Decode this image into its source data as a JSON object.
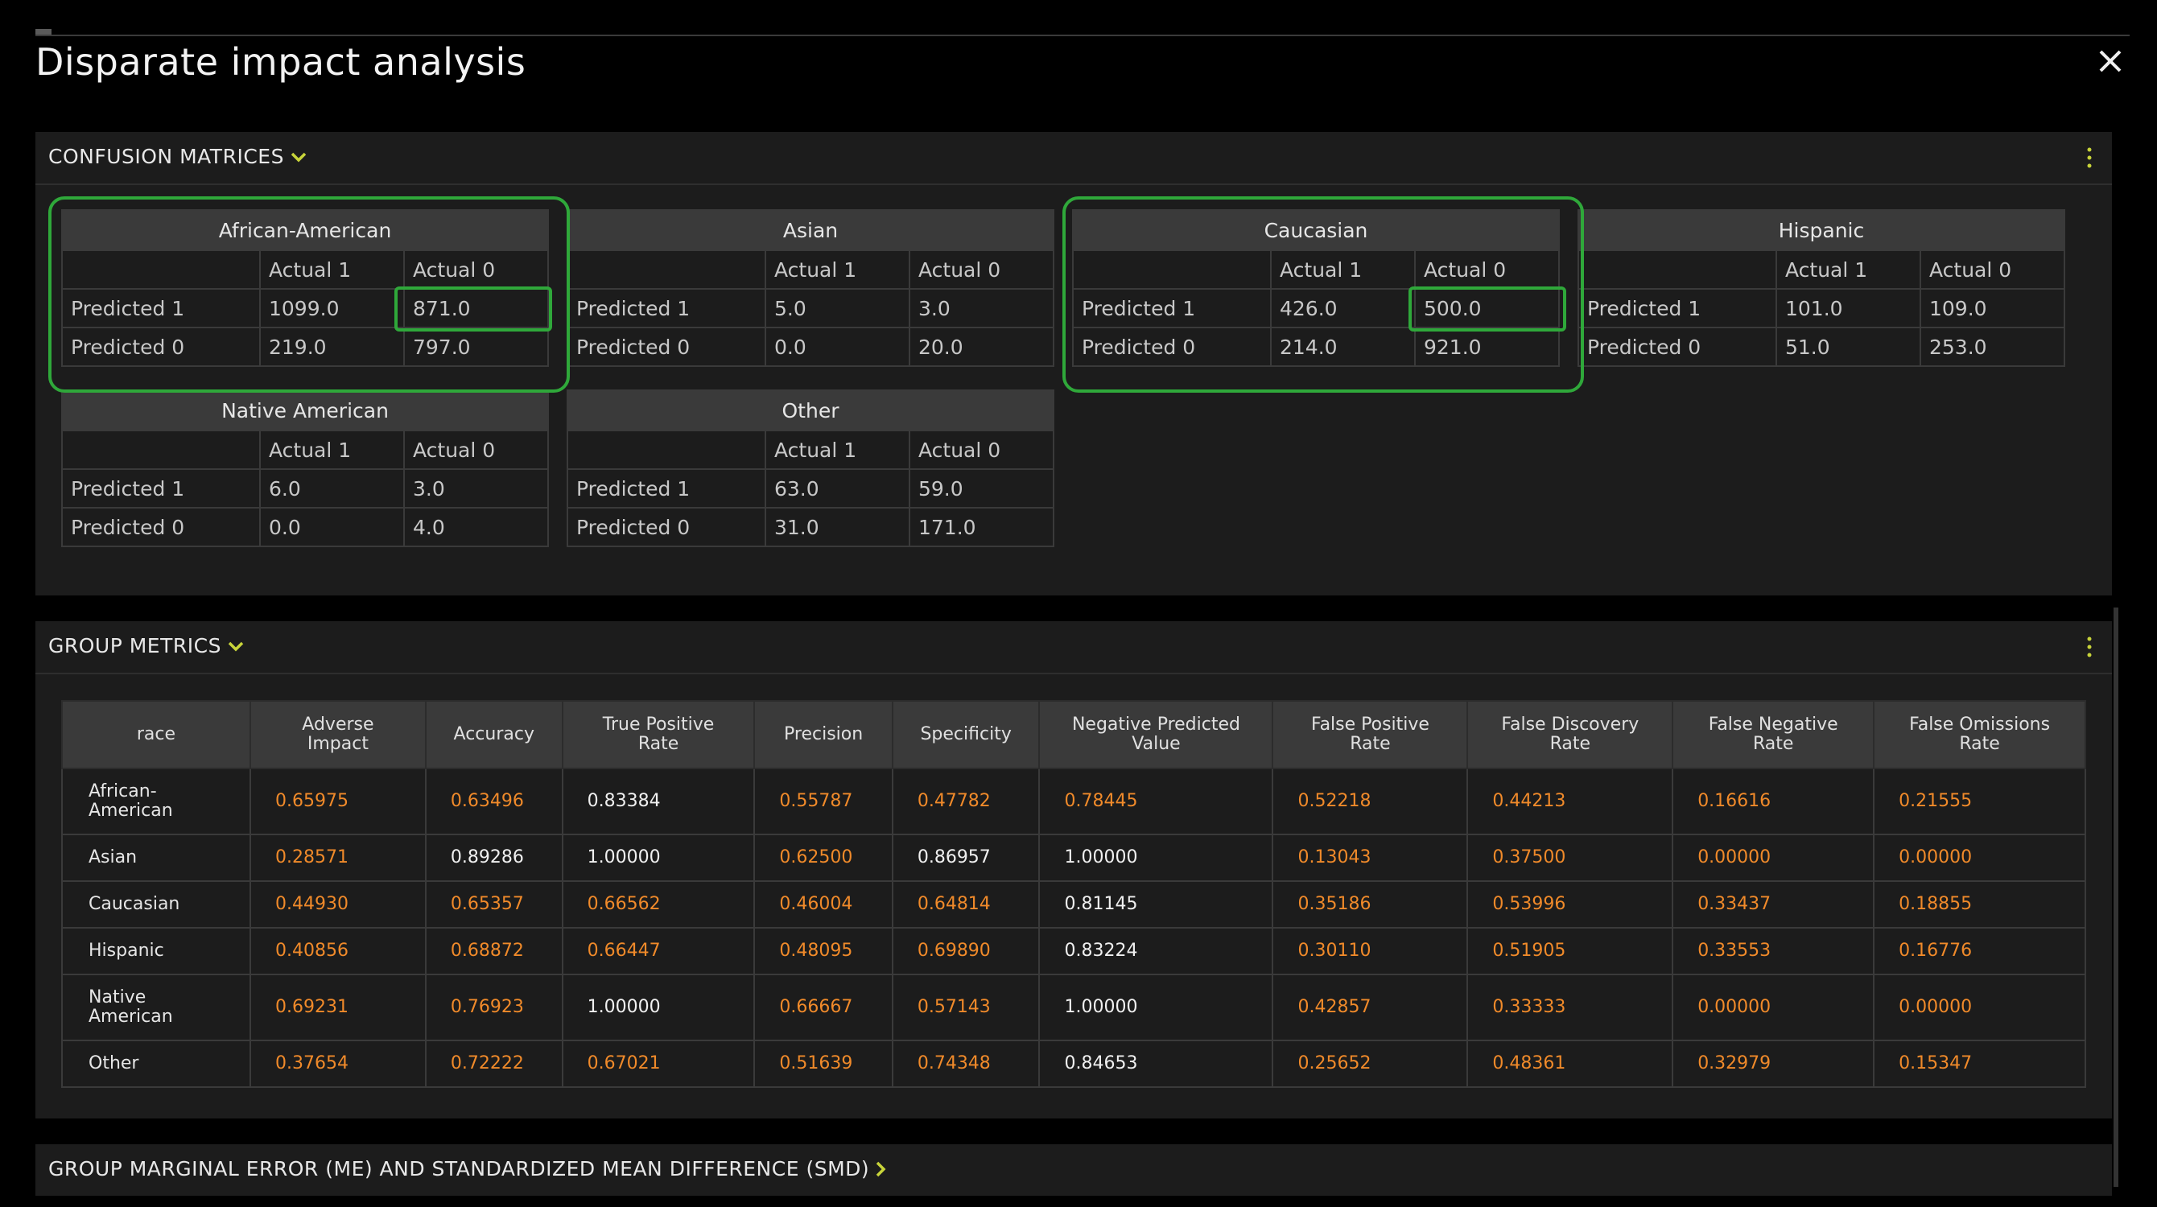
{
  "dialog": {
    "title": "Disparate impact analysis"
  },
  "confusion": {
    "section_title": "CONFUSION MATRICES",
    "col_headers": [
      "Actual 1",
      "Actual 0"
    ],
    "row_headers": [
      "Predicted 1",
      "Predicted 0"
    ],
    "groups": [
      {
        "name": "African-American",
        "p1": [
          "1099.0",
          "871.0"
        ],
        "p0": [
          "219.0",
          "797.0"
        ]
      },
      {
        "name": "Asian",
        "p1": [
          "5.0",
          "3.0"
        ],
        "p0": [
          "0.0",
          "20.0"
        ]
      },
      {
        "name": "Caucasian",
        "p1": [
          "426.0",
          "500.0"
        ],
        "p0": [
          "214.0",
          "921.0"
        ]
      },
      {
        "name": "Hispanic",
        "p1": [
          "101.0",
          "109.0"
        ],
        "p0": [
          "51.0",
          "253.0"
        ]
      },
      {
        "name": "Native American",
        "p1": [
          "6.0",
          "3.0"
        ],
        "p0": [
          "0.0",
          "4.0"
        ]
      },
      {
        "name": "Other",
        "p1": [
          "63.0",
          "59.0"
        ],
        "p0": [
          "31.0",
          "171.0"
        ]
      }
    ]
  },
  "metrics": {
    "section_title": "GROUP METRICS",
    "headers": [
      "race",
      "Adverse\nImpact",
      "Accuracy",
      "True Positive\nRate",
      "Precision",
      "Specificity",
      "Negative Predicted\nValue",
      "False Positive\nRate",
      "False Discovery\nRate",
      "False Negative\nRate",
      "False Omissions\nRate"
    ],
    "rows": [
      {
        "race": "African-\nAmerican",
        "values": [
          "0.65975",
          "0.63496",
          "0.83384",
          "0.55787",
          "0.47782",
          "0.78445",
          "0.52218",
          "0.44213",
          "0.16616",
          "0.21555"
        ],
        "white": [
          2
        ]
      },
      {
        "race": "Asian",
        "values": [
          "0.28571",
          "0.89286",
          "1.00000",
          "0.62500",
          "0.86957",
          "1.00000",
          "0.13043",
          "0.37500",
          "0.00000",
          "0.00000"
        ],
        "white": [
          1,
          2,
          4,
          5
        ]
      },
      {
        "race": "Caucasian",
        "values": [
          "0.44930",
          "0.65357",
          "0.66562",
          "0.46004",
          "0.64814",
          "0.81145",
          "0.35186",
          "0.53996",
          "0.33437",
          "0.18855"
        ],
        "white": [
          5
        ]
      },
      {
        "race": "Hispanic",
        "values": [
          "0.40856",
          "0.68872",
          "0.66447",
          "0.48095",
          "0.69890",
          "0.83224",
          "0.30110",
          "0.51905",
          "0.33553",
          "0.16776"
        ],
        "white": [
          5
        ]
      },
      {
        "race": "Native\nAmerican",
        "values": [
          "0.69231",
          "0.76923",
          "1.00000",
          "0.66667",
          "0.57143",
          "1.00000",
          "0.42857",
          "0.33333",
          "0.00000",
          "0.00000"
        ],
        "white": [
          2,
          5
        ]
      },
      {
        "race": "Other",
        "values": [
          "0.37654",
          "0.72222",
          "0.67021",
          "0.51639",
          "0.74348",
          "0.84653",
          "0.25652",
          "0.48361",
          "0.32979",
          "0.15347"
        ],
        "white": [
          5
        ]
      }
    ]
  },
  "me_smd": {
    "section_title": "GROUP MARGINAL ERROR (ME) AND STANDARDIZED MEAN DIFFERENCE (SMD)"
  },
  "colors": {
    "accent": "#c8d43a",
    "highlight": "#2fa83a",
    "value": "#f08a2a"
  },
  "icons": [
    "close-icon",
    "chevron-down-icon",
    "chevron-right-icon",
    "kebab-menu-icon"
  ]
}
